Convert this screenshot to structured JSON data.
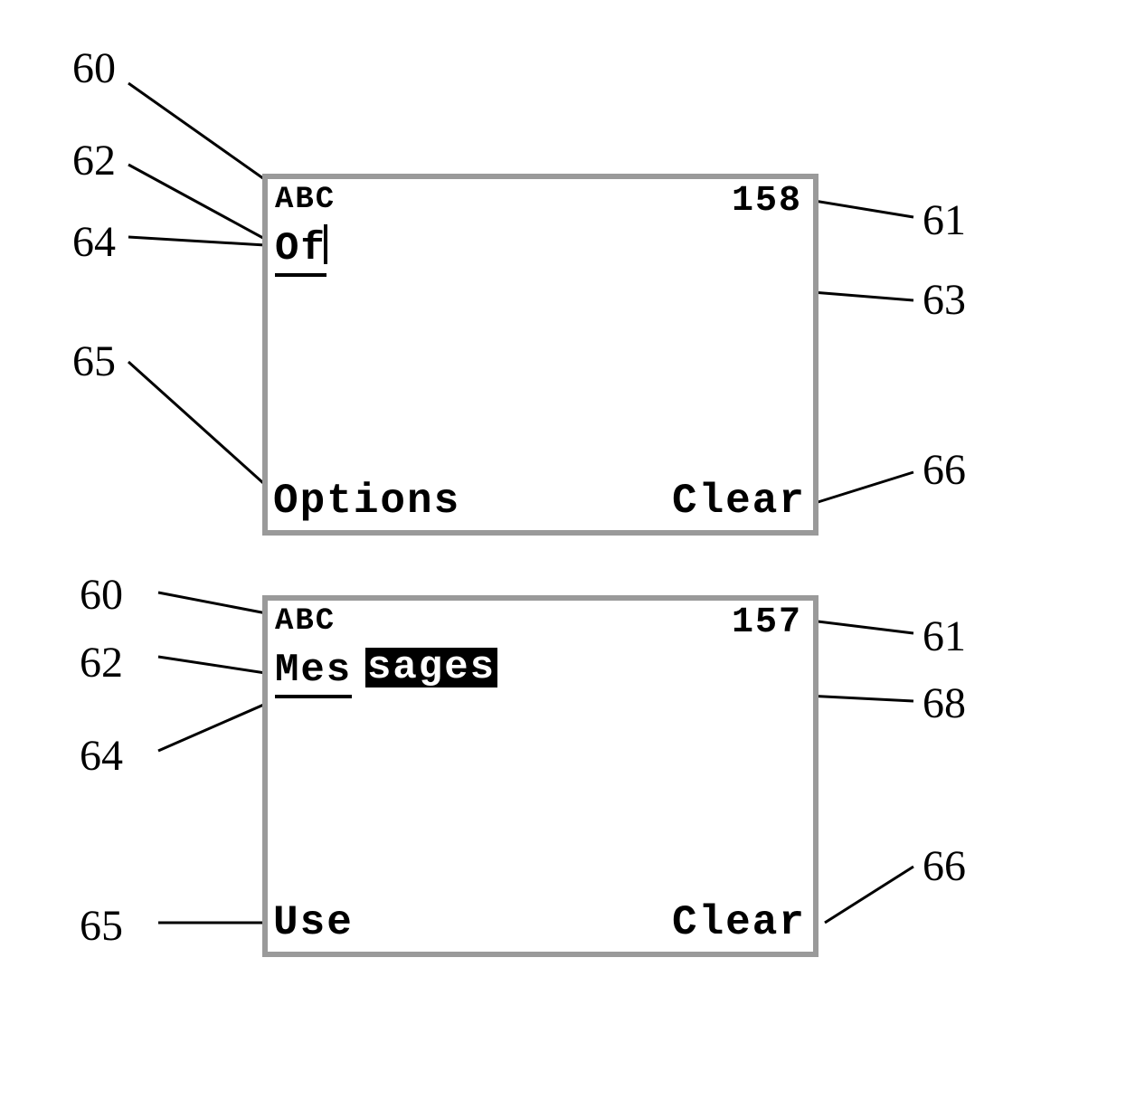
{
  "screens": [
    {
      "mode": "ABC",
      "count": "158",
      "text_typed": "Of",
      "left_softkey": "Options",
      "right_softkey": "Clear"
    },
    {
      "mode": "ABC",
      "count": "157",
      "text_typed": "Mes",
      "text_suggested": "sages",
      "left_softkey": "Use",
      "right_softkey": "Clear"
    }
  ],
  "callouts": {
    "c60": "60",
    "c61": "61",
    "c62": "62",
    "c63": "63",
    "c64": "64",
    "c65": "65",
    "c66": "66",
    "c68": "68"
  }
}
